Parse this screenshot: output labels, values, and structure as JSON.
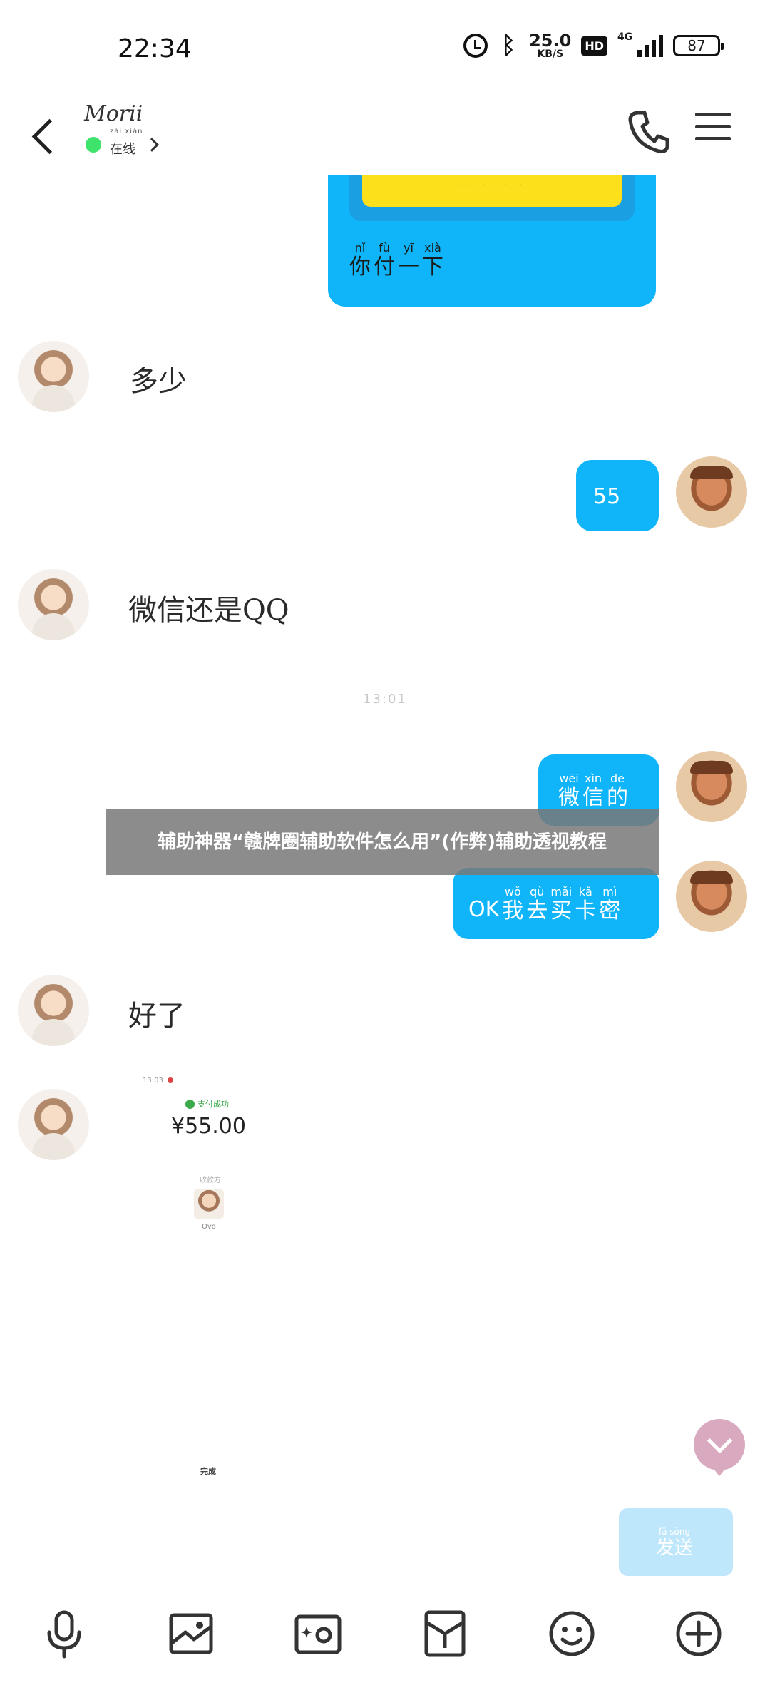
{
  "status_bar": {
    "time": "22:34",
    "net_speed_value": "25.0",
    "net_speed_unit": "KB/S",
    "hd_label": "HD",
    "signal_type": "4G",
    "battery": "87"
  },
  "header": {
    "contact_name": "Morii",
    "presence_pinyin": "zài xiàn",
    "presence_text": "在线"
  },
  "messages": {
    "card_caption": [
      {
        "pinyin": "nǐ",
        "char": "你"
      },
      {
        "pinyin": "fù",
        "char": "付"
      },
      {
        "pinyin": "yī",
        "char": "一"
      },
      {
        "pinyin": "xià",
        "char": "下"
      }
    ],
    "recv_1": "多少",
    "sent_1": "55",
    "recv_2": "微信还是QQ",
    "timestamp": "13:01",
    "sent_2": [
      {
        "pinyin": "wēi",
        "char": "微"
      },
      {
        "pinyin": "xìn",
        "char": "信"
      },
      {
        "pinyin": "de",
        "char": "的"
      }
    ],
    "sent_3_prefix": "OK",
    "sent_3": [
      {
        "pinyin": "wǒ",
        "char": "我"
      },
      {
        "pinyin": "qù",
        "char": "去"
      },
      {
        "pinyin": "mǎi",
        "char": "买"
      },
      {
        "pinyin": "kǎ",
        "char": "卡"
      },
      {
        "pinyin": "mì",
        "char": "密"
      }
    ],
    "recv_3": "好了"
  },
  "receipt": {
    "status_bar_text": "13:03",
    "status": "支付成功",
    "amount": "¥55.00",
    "payee_label": "收款方",
    "payer_name": "Ovo",
    "done_label": "完成"
  },
  "overlay_title": "辅助神器“赣牌圈辅助软件怎么用”(作弊)辅助透视教程",
  "send_button": {
    "pinyin": "fā sòng",
    "label": "发送"
  },
  "toolbar": {
    "icons": [
      "mic-icon",
      "image-icon",
      "camera-icon",
      "red-packet-icon",
      "emoji-icon",
      "plus-icon"
    ]
  },
  "colors": {
    "bubble_out": "#10b4f8",
    "card_yellow": "#fce01c",
    "online_dot": "#3ee36b",
    "scroll_button": "#d9a9bf",
    "send_button_disabled": "#bfe7fb"
  }
}
